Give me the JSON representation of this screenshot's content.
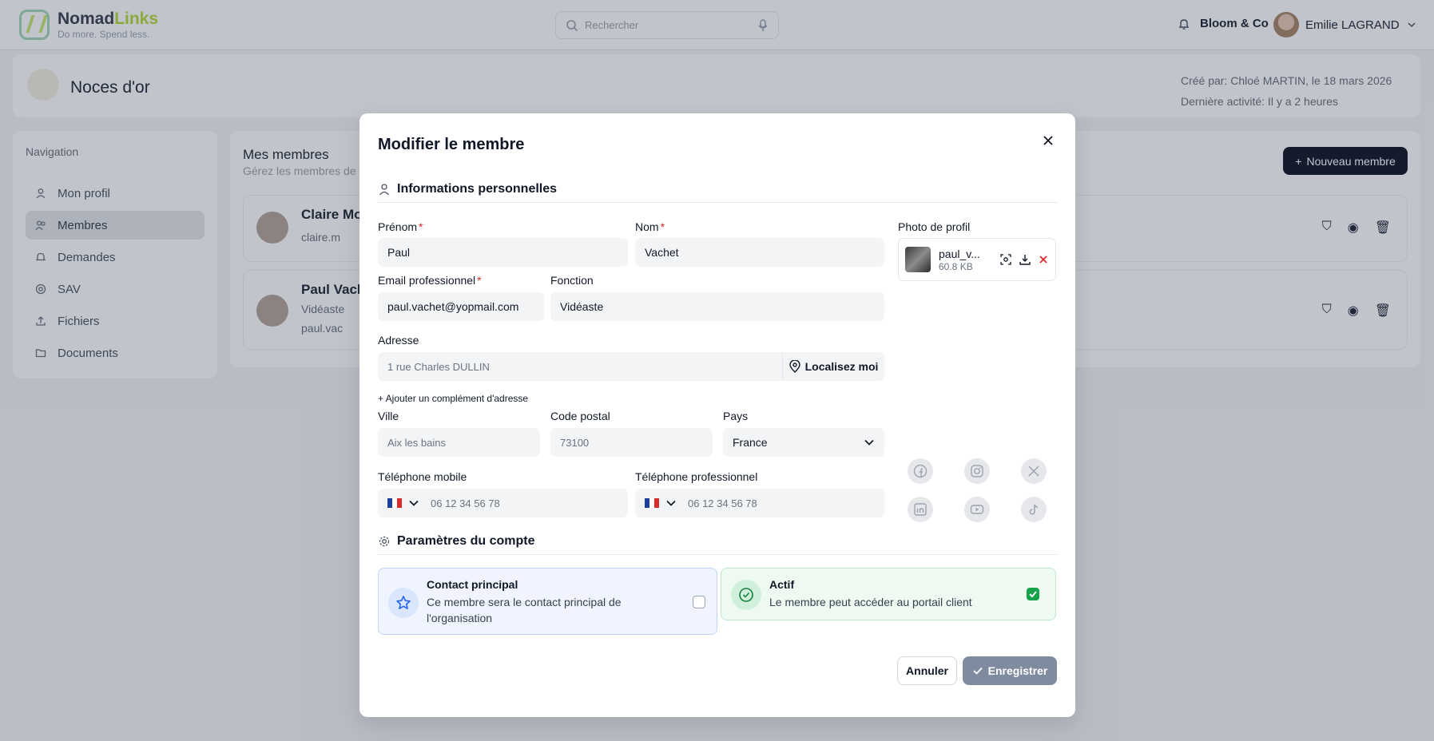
{
  "topbar": {
    "brand": {
      "name_prefix": "Nomad",
      "name_suffix": "Links",
      "tagline": "Do more. Spend less."
    },
    "search": {
      "placeholder": "Rechercher"
    },
    "organization": "Bloom & Co",
    "user_name": "Emilie LAGRAND"
  },
  "project": {
    "title": "Noces d'or",
    "created_by": "Créé par: Chloé MARTIN, le 18 mars 2026",
    "last_activity": "Dernière activité: Il y a 2 heures"
  },
  "navigation": {
    "title": "Navigation",
    "items": [
      {
        "label": "Mon profil",
        "icon": "user-icon"
      },
      {
        "label": "Membres",
        "icon": "users-icon",
        "active": true
      },
      {
        "label": "Demandes",
        "icon": "bell-icon"
      },
      {
        "label": "SAV",
        "icon": "lifebuoy-icon"
      },
      {
        "label": "Fichiers",
        "icon": "upload-icon"
      },
      {
        "label": "Documents",
        "icon": "folder-icon"
      }
    ]
  },
  "members": {
    "title": "Mes membres",
    "subtitle": "Gérez les membres de v",
    "new_button": "Nouveau membre",
    "rows": [
      {
        "name": "Claire Moc",
        "function": "",
        "email": "claire.m"
      },
      {
        "name": "Paul Vache",
        "function": "Vidéaste",
        "email": "paul.vac"
      }
    ]
  },
  "modal": {
    "title": "Modifier le membre",
    "personal_section": "Informations personnelles",
    "fields": {
      "prenom": {
        "label": "Prénom",
        "value": "Paul"
      },
      "nom": {
        "label": "Nom",
        "value": "Vachet"
      },
      "email": {
        "label": "Email professionnel",
        "value": "paul.vachet@yopmail.com"
      },
      "fonction": {
        "label": "Fonction",
        "value": "Vidéaste"
      },
      "adresse": {
        "label": "Adresse",
        "placeholder": "1 rue Charles DULLIN"
      },
      "ville": {
        "label": "Ville",
        "placeholder": "Aix les bains"
      },
      "code_postal": {
        "label": "Code postal",
        "placeholder": "73100"
      },
      "pays": {
        "label": "Pays",
        "value": "France"
      },
      "tel_mobile": {
        "label": "Téléphone mobile",
        "placeholder": "06 12 34 56 78"
      },
      "tel_pro": {
        "label": "Téléphone professionnel",
        "placeholder": "06 12 34 56 78"
      }
    },
    "required_mark": "*",
    "localize_button": "Localisez moi",
    "add_address_complement": "+ Ajouter un complément d'adresse",
    "photo": {
      "label": "Photo de profil",
      "file_name": "paul_v...",
      "file_size": "60.8 KB"
    },
    "socials": [
      "facebook-icon",
      "instagram-icon",
      "x-icon",
      "linkedin-icon",
      "youtube-icon",
      "tiktok-icon"
    ],
    "account_section": "Paramètres du compte",
    "options": {
      "contact": {
        "title": "Contact principal",
        "description": "Ce membre sera le contact principal de l'organisation",
        "checked": false
      },
      "actif": {
        "title": "Actif",
        "description": "Le membre peut accéder au portail client",
        "checked": true
      }
    },
    "cancel_button": "Annuler",
    "save_button": "Enregistrer"
  },
  "colors": {
    "brand_green": "#b6db3c",
    "required_red": "#dc2626",
    "active_green": "#16a34a",
    "contact_blue": "#2563eb"
  }
}
